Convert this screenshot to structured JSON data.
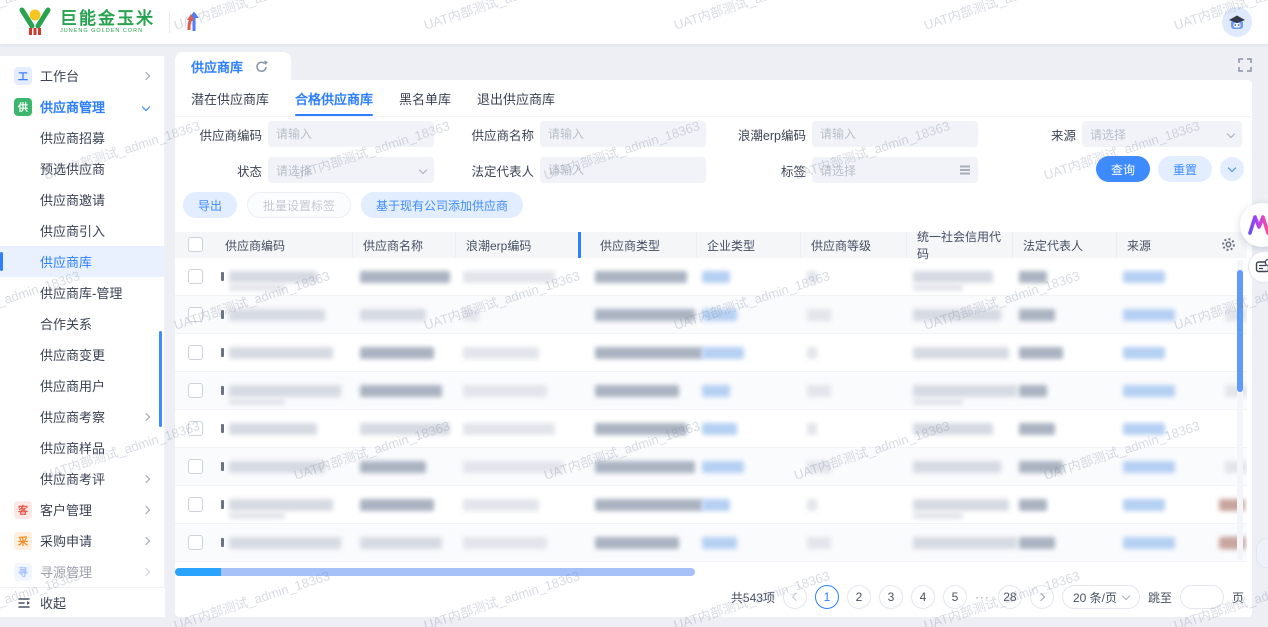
{
  "header": {
    "brand_name": "巨能金玉米",
    "brand_subtitle": "JUNENG GOLDEN CORN"
  },
  "sidebar": {
    "items": [
      {
        "label": "工作台",
        "icon_text": "工",
        "type": "parent",
        "chevron": "right"
      },
      {
        "label": "供应商管理",
        "icon_text": "供",
        "type": "parent",
        "chevron": "down",
        "active": true
      },
      {
        "label": "供应商招募",
        "type": "child"
      },
      {
        "label": "预选供应商",
        "type": "child"
      },
      {
        "label": "供应商邀请",
        "type": "child"
      },
      {
        "label": "供应商引入",
        "type": "child"
      },
      {
        "label": "供应商库",
        "type": "child",
        "active": true
      },
      {
        "label": "供应商库-管理",
        "type": "child"
      },
      {
        "label": "合作关系",
        "type": "child"
      },
      {
        "label": "供应商变更",
        "type": "child"
      },
      {
        "label": "供应商用户",
        "type": "child"
      },
      {
        "label": "供应商考察",
        "type": "child",
        "chevron": "right"
      },
      {
        "label": "供应商样品",
        "type": "child"
      },
      {
        "label": "供应商考评",
        "type": "child",
        "chevron": "right"
      },
      {
        "label": "客户管理",
        "icon_text": "客",
        "type": "parent",
        "chevron": "right"
      },
      {
        "label": "采购申请",
        "icon_text": "采",
        "type": "parent",
        "chevron": "right"
      },
      {
        "label": "寻源管理",
        "icon_text": "寻",
        "type": "parent",
        "chevron": "right",
        "clipped": true
      }
    ],
    "collapse_label": "收起"
  },
  "tabbar": {
    "active_tab": "供应商库"
  },
  "subtabs": {
    "items": [
      "潜在供应商库",
      "合格供应商库",
      "黑名单库",
      "退出供应商库"
    ],
    "active_index": 1
  },
  "filters": {
    "fields": [
      {
        "label": "供应商编码",
        "placeholder": "请输入",
        "control": "input"
      },
      {
        "label": "供应商名称",
        "placeholder": "请输入",
        "control": "input"
      },
      {
        "label": "浪潮erp编码",
        "placeholder": "请输入",
        "control": "input"
      },
      {
        "label": "来源",
        "placeholder": "请选择",
        "control": "select"
      },
      {
        "label": "状态",
        "placeholder": "请选择",
        "control": "select"
      },
      {
        "label": "法定代表人",
        "placeholder": "请输入",
        "control": "input"
      },
      {
        "label": "标签",
        "placeholder": "请选择",
        "control": "multiselect"
      }
    ],
    "query_label": "查询",
    "reset_label": "重置"
  },
  "actions": {
    "export_label": "导出",
    "batch_tag_label": "批量设置标签",
    "add_from_company_label": "基于现有公司添加供应商"
  },
  "table": {
    "columns": [
      "供应商编码",
      "供应商名称",
      "浪潮erp编码",
      "供应商类型",
      "企业类型",
      "供应商等级",
      "统一社会信用代码",
      "法定代表人",
      "来源"
    ],
    "redacted_rows": 8
  },
  "pagination": {
    "total_text": "共543项",
    "pages": [
      "1",
      "2",
      "3",
      "4",
      "5",
      "···",
      "28"
    ],
    "active_page": "1",
    "page_size_text": "20 条/页",
    "jump_label": "跳至",
    "page_unit": "页"
  },
  "watermark": {
    "text": "UAT内部测试_admin_18363"
  },
  "colors": {
    "primary": "#2e7fff",
    "brand_green": "#27a34f"
  }
}
